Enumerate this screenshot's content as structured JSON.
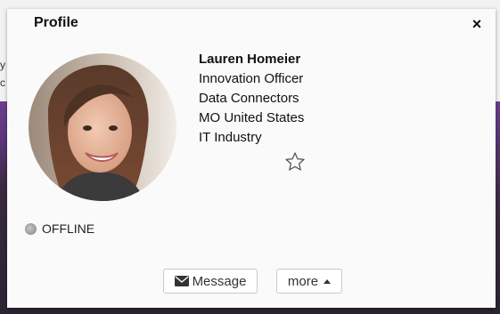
{
  "dialog": {
    "title": "Profile",
    "close_symbol": "×"
  },
  "profile": {
    "avatar_icon": "user-photo",
    "name": "Lauren Homeier",
    "title": "Innovation Officer",
    "company": "Data Connectors",
    "location": "MO United States",
    "industry": "IT Industry",
    "favorite_icon": "star-outline-icon"
  },
  "status": {
    "label": "OFFLINE",
    "dot_color": "#9a9a9a"
  },
  "actions": {
    "message_label": "Message",
    "message_icon": "envelope-icon",
    "more_label": "more",
    "more_icon": "caret-up-icon"
  },
  "background": {
    "accent_color": "#6b3f8f"
  }
}
